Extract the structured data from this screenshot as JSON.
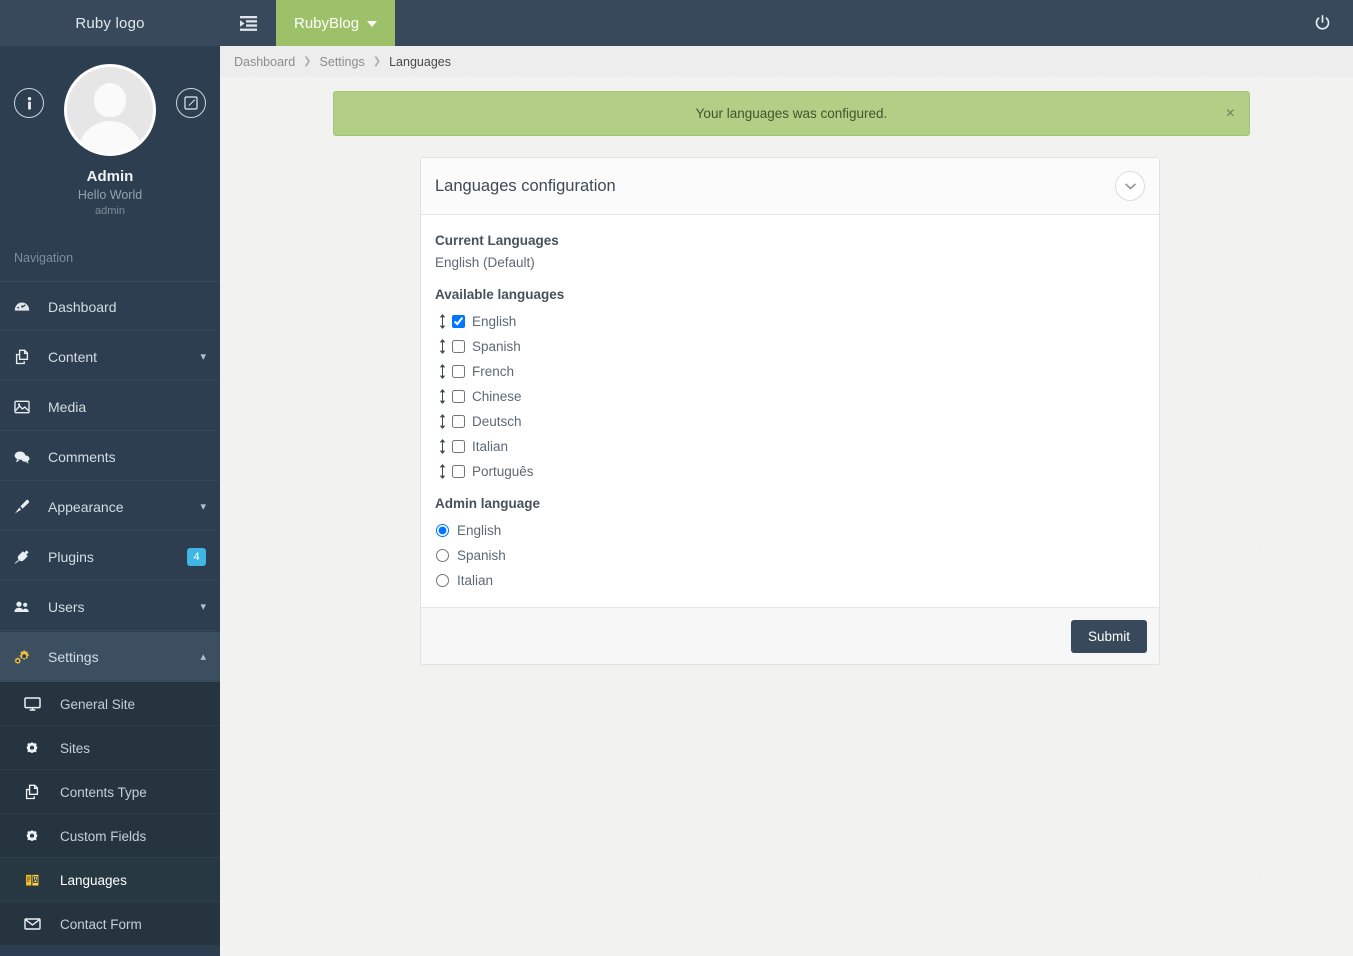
{
  "topbar": {
    "brand": "Ruby logo",
    "toggle_icon": "sidebar-collapse-icon",
    "site_name": "RubyBlog",
    "logout_icon": "power-icon"
  },
  "sidebar": {
    "profile": {
      "name": "Admin",
      "tagline": "Hello World",
      "role": "admin",
      "info_icon": "info-icon",
      "edit_icon": "edit-pencil-icon"
    },
    "nav_heading": "Navigation",
    "items": [
      {
        "label": "Dashboard",
        "icon": "dashboard-icon",
        "chevron": "",
        "badge": "",
        "active": false
      },
      {
        "label": "Content",
        "icon": "content-icon",
        "chevron": "▾",
        "badge": "",
        "active": false
      },
      {
        "label": "Media",
        "icon": "media-icon",
        "chevron": "",
        "badge": "",
        "active": false
      },
      {
        "label": "Comments",
        "icon": "comments-icon",
        "chevron": "",
        "badge": "",
        "active": false
      },
      {
        "label": "Appearance",
        "icon": "brush-icon",
        "chevron": "▾",
        "badge": "",
        "active": false
      },
      {
        "label": "Plugins",
        "icon": "plug-icon",
        "chevron": "",
        "badge": "4",
        "active": false
      },
      {
        "label": "Users",
        "icon": "users-icon",
        "chevron": "▾",
        "badge": "",
        "active": false
      },
      {
        "label": "Settings",
        "icon": "gears-icon",
        "chevron": "▴",
        "badge": "",
        "active": true
      }
    ],
    "subitems": [
      {
        "label": "General Site",
        "icon": "monitor-icon",
        "active": false
      },
      {
        "label": "Sites",
        "icon": "gear-icon",
        "active": false
      },
      {
        "label": "Contents Type",
        "icon": "content-icon",
        "active": false
      },
      {
        "label": "Custom Fields",
        "icon": "gear-icon",
        "active": false
      },
      {
        "label": "Languages",
        "icon": "language-book-icon",
        "active": true
      },
      {
        "label": "Contact Form",
        "icon": "envelope-icon",
        "active": false
      }
    ]
  },
  "breadcrumb": [
    {
      "label": "Dashboard",
      "current": false
    },
    {
      "label": "Settings",
      "current": false
    },
    {
      "label": "Languages",
      "current": true
    }
  ],
  "alert": {
    "message": "Your languages was configured.",
    "close_icon": "close-icon"
  },
  "panel": {
    "title": "Languages configuration",
    "collapse_icon": "chevron-down-icon",
    "current_languages_label": "Current Languages",
    "current_languages_value": "English (Default)",
    "available_languages_label": "Available languages",
    "available_languages": [
      {
        "name": "English",
        "checked": true
      },
      {
        "name": "Spanish",
        "checked": false
      },
      {
        "name": "French",
        "checked": false
      },
      {
        "name": "Chinese",
        "checked": false
      },
      {
        "name": "Deutsch",
        "checked": false
      },
      {
        "name": "Italian",
        "checked": false
      },
      {
        "name": "Português",
        "checked": false
      }
    ],
    "admin_language_label": "Admin language",
    "admin_languages": [
      {
        "name": "English",
        "selected": true
      },
      {
        "name": "Spanish",
        "selected": false
      },
      {
        "name": "Italian",
        "selected": false
      }
    ],
    "submit_label": "Submit"
  },
  "colors": {
    "topbar": "#37495a",
    "sidebar": "#2c3e4f",
    "accent_green": "#9cc169",
    "alert_green": "#b3cf86",
    "badge_blue": "#3fb6e3",
    "submit_dark": "#37495a",
    "languages_icon_gold": "#f0c23c"
  }
}
